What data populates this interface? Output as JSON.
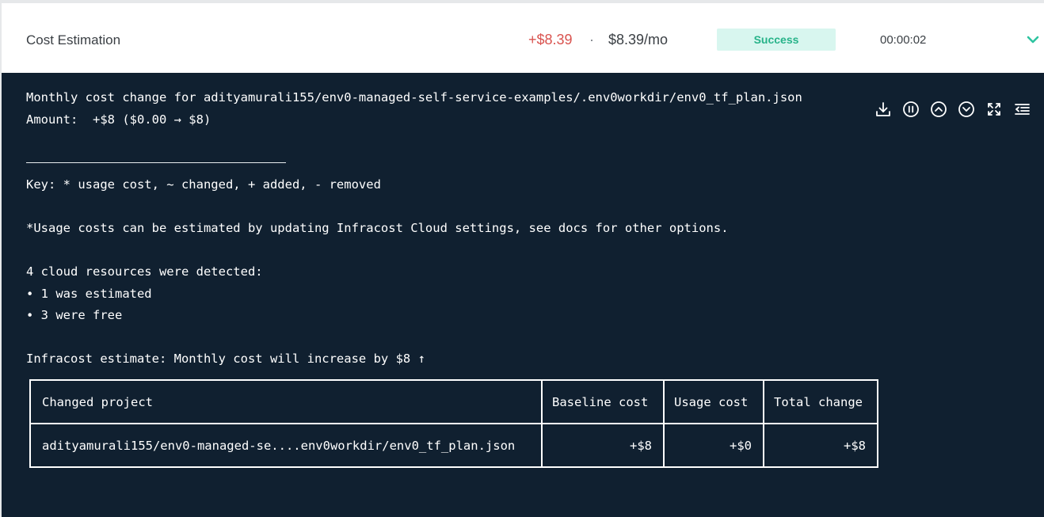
{
  "step": {
    "title": "Cost Estimation",
    "cost_change": "+$8.39",
    "separator": "·",
    "monthly_cost": "$8.39/mo",
    "status": "Success",
    "duration": "00:00:02",
    "expand_icon": "chevron-down-icon"
  },
  "colors": {
    "cost_change": "#d9534f",
    "status_bg": "#d8f6ef",
    "status_text": "#27b389",
    "log_bg": "#102030",
    "chevron": "#2ec4a0"
  },
  "toolbar": {
    "icons": [
      "download-icon",
      "pause-icon",
      "scroll-up-icon",
      "scroll-down-icon",
      "fullscreen-icon",
      "collapse-lines-icon"
    ]
  },
  "log": {
    "line1": "Monthly cost change for adityamurali155/env0-managed-self-service-examples/.env0workdir/env0_tf_plan.json",
    "line2": "Amount:  +$8 ($0.00 → $8)",
    "key": "Key: * usage cost, ~ changed, + added, - removed",
    "usage_note": "*Usage costs can be estimated by updating Infracost Cloud settings, see docs for other options.",
    "detected": "4 cloud resources were detected:",
    "estimated": "∙ 1 was estimated",
    "free": "∙ 3 were free",
    "estimate_summary": "Infracost estimate: Monthly cost will increase by $8 ↑"
  },
  "table": {
    "headers": [
      "Changed project",
      "Baseline cost",
      "Usage cost",
      "Total change"
    ],
    "row": [
      "adityamurali155/env0-managed-se....env0workdir/env0_tf_plan.json",
      "+$8",
      "+$0",
      "+$8"
    ]
  }
}
